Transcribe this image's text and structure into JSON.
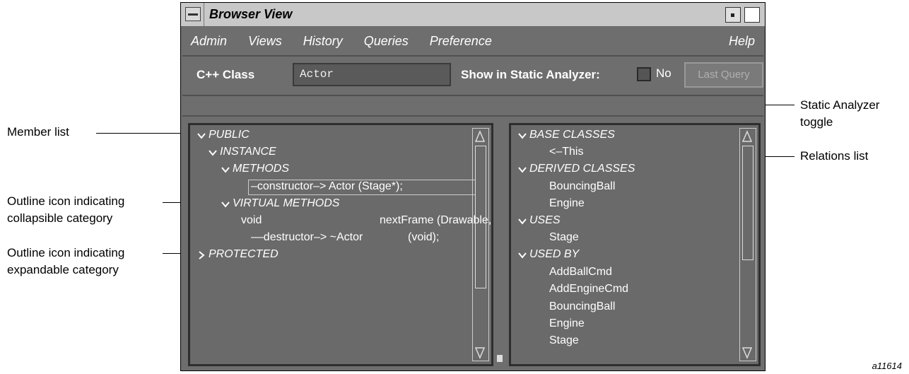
{
  "callouts": {
    "member_list": "Member list",
    "collapsible_line1": "Outline icon indicating",
    "collapsible_line2": "collapsible category",
    "expandable_line1": "Outline icon indicating",
    "expandable_line2": "expandable category",
    "toggle_line1": "Static Analyzer",
    "toggle_line2": "toggle",
    "relations_list": "Relations list",
    "figure_id": "a11614"
  },
  "window": {
    "title": "Browser View"
  },
  "menu": {
    "items": [
      "Admin",
      "Views",
      "History",
      "Queries",
      "Preference"
    ],
    "help": "Help"
  },
  "query_row": {
    "class_label": "C++ Class",
    "class_value": "Actor",
    "show_label": "Show in Static Analyzer:",
    "toggle_value": "No",
    "last_query_label": "Last Query"
  },
  "member_list": {
    "public": "PUBLIC",
    "instance": "INSTANCE",
    "methods": "METHODS",
    "constructor_row": "–constructor–> Actor (Stage*);",
    "virtual_methods": "VIRTUAL METHODS",
    "void_type": "void",
    "next_frame": "nextFrame (Drawable,",
    "destructor_row": "––destructor–> ~Actor",
    "destructor_args": "(void);",
    "protected": "PROTECTED"
  },
  "relations_list": {
    "base_classes": "BASE CLASSES",
    "this_item": "<–This",
    "derived_classes": "DERIVED CLASSES",
    "derived_items": [
      "BouncingBall",
      "Engine"
    ],
    "uses": "USES",
    "uses_items": [
      "Stage"
    ],
    "used_by": "USED BY",
    "used_by_items": [
      "AddBallCmd",
      "AddEngineCmd",
      "BouncingBall",
      "Engine",
      "Stage"
    ]
  },
  "colors": {
    "window_bg": "#6e6e6e",
    "titlebar": "#c8c8c8",
    "text_light": "#ffffff"
  }
}
